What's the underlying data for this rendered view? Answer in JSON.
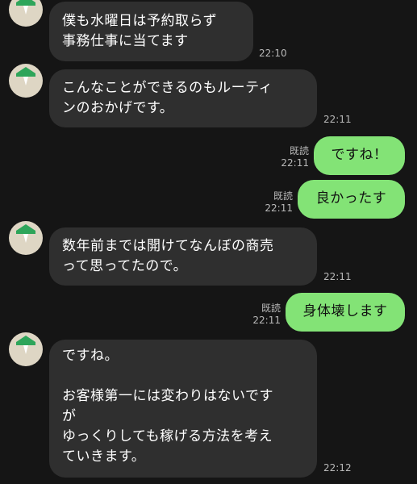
{
  "colors": {
    "background": "#151515",
    "incoming_bubble": "#2f2f2f",
    "outgoing_bubble": "#83e376",
    "avatar_background": "#ded6c4",
    "avatar_leaf": "#2ea55a"
  },
  "avatar_icon": "green-leaf-avatar-icon",
  "messages": [
    {
      "direction": "in",
      "text": "僕も水曜日は予約取らず\n事務仕事に当てます",
      "time": "22:10"
    },
    {
      "direction": "in",
      "text": "こんなことができるのもルーティ\nンのおかげです。",
      "time": "22:11"
    },
    {
      "direction": "out",
      "text": "ですね！",
      "read": "既読",
      "time": "22:11"
    },
    {
      "direction": "out",
      "text": "良かったす",
      "read": "既読",
      "time": "22:11"
    },
    {
      "direction": "in",
      "text": "数年前までは開けてなんぼの商売\nって思ってたので。",
      "time": "22:11"
    },
    {
      "direction": "out",
      "text": "身体壊します",
      "read": "既読",
      "time": "22:11"
    },
    {
      "direction": "in",
      "text": "ですね。\n\nお客様第一には変わりはないです\nが\nゆっくりしても稼げる方法を考え\nていきます。",
      "time": "22:12"
    }
  ]
}
